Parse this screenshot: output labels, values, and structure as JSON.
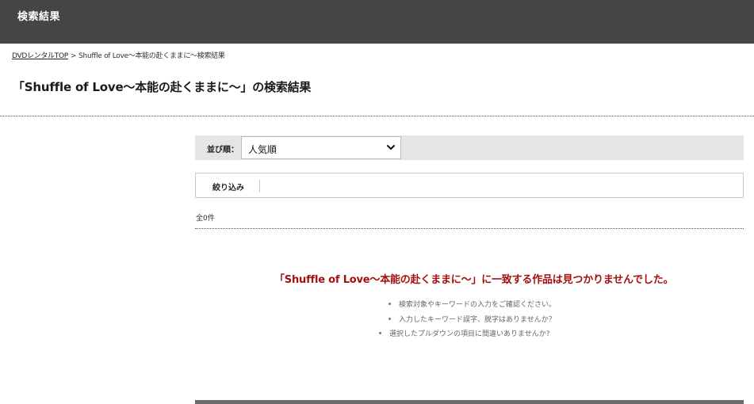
{
  "header": {
    "title": "検索結果"
  },
  "breadcrumb": {
    "home": "DVDレンタルTOP",
    "separator": ">",
    "current": "Shuffle of Love〜本能の赴くままに〜検索結果"
  },
  "page": {
    "title": "「Shuffle of Love〜本能の赴くままに〜」の検索結果"
  },
  "sort": {
    "label": "並び順：",
    "selected": "人気順",
    "icon": "chevron-down-icon"
  },
  "filter": {
    "label": "絞り込み"
  },
  "results": {
    "count_text": "全0件"
  },
  "no_results": {
    "title": "「Shuffle of Love〜本能の赴くままに〜」に一致する作品は見つかりませんでした。",
    "tips": [
      "検索対象やキーワードの入力をご確認ください。",
      "入力したキーワード誤字、脱字はありませんか？",
      "選択したプルダウンの項目に間違いありませんか?"
    ],
    "title_color": "#a31010"
  },
  "colors": {
    "header_bg": "#454545",
    "sortbar_bg": "#e5e5e5"
  }
}
